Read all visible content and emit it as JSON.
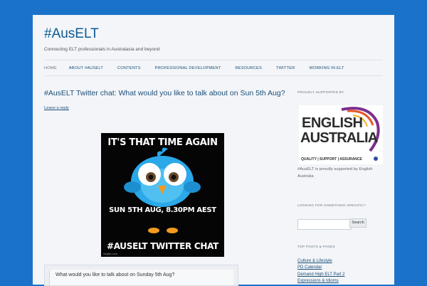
{
  "site": {
    "title": "#AusELT",
    "description": "Connecting ELT professionals in Australasia and beyond"
  },
  "nav": {
    "items": [
      "HOME",
      "ABOUT #AUSELT",
      "CONTENTS",
      "PROFESSIONAL DEVELOPMENT",
      "RESOURCES",
      "TWITTER",
      "WORKING IN ELT"
    ]
  },
  "post": {
    "title": "#AusELT Twitter chat: What would you like to talk about on Sun 5th Aug?",
    "reply_label": "Leave a reply",
    "meme": {
      "line1": "IT'S THAT TIME AGAIN",
      "line2": "SUN 5TH AUG, 8.30PM AEST",
      "line3": "#AUSELT TWITTER CHAT",
      "credit": "imgflip.com"
    },
    "quote": "What would you like to talk about on Sunday 5th Aug?"
  },
  "sidebar": {
    "supported_heading": "PROUDLY SUPPORTED BY",
    "logo": {
      "line1": "ENGLISH",
      "line2": "AUSTRALIA",
      "tagline": "QUALITY | SUPPORT | ASSURANCE",
      "brand_colors": [
        "#e8562a",
        "#f3b21a",
        "#7b2f8e",
        "#2f4fa0"
      ]
    },
    "supported_text": "#AusELT is proudly supported by English Australia",
    "search_heading": "LOOKING FOR SOMETHING SPECIFIC?",
    "search_placeholder": "",
    "search_button": "Search",
    "top_posts_heading": "TOP POSTS & PAGES",
    "top_posts": [
      "Culture & Lifestyle",
      "PD Calendar",
      "Demand High ELT Part 2",
      "Expressions & Idioms"
    ]
  },
  "colors": {
    "background": "#1a73c9",
    "page": "#f3f5f8",
    "link": "#1b4f79"
  }
}
